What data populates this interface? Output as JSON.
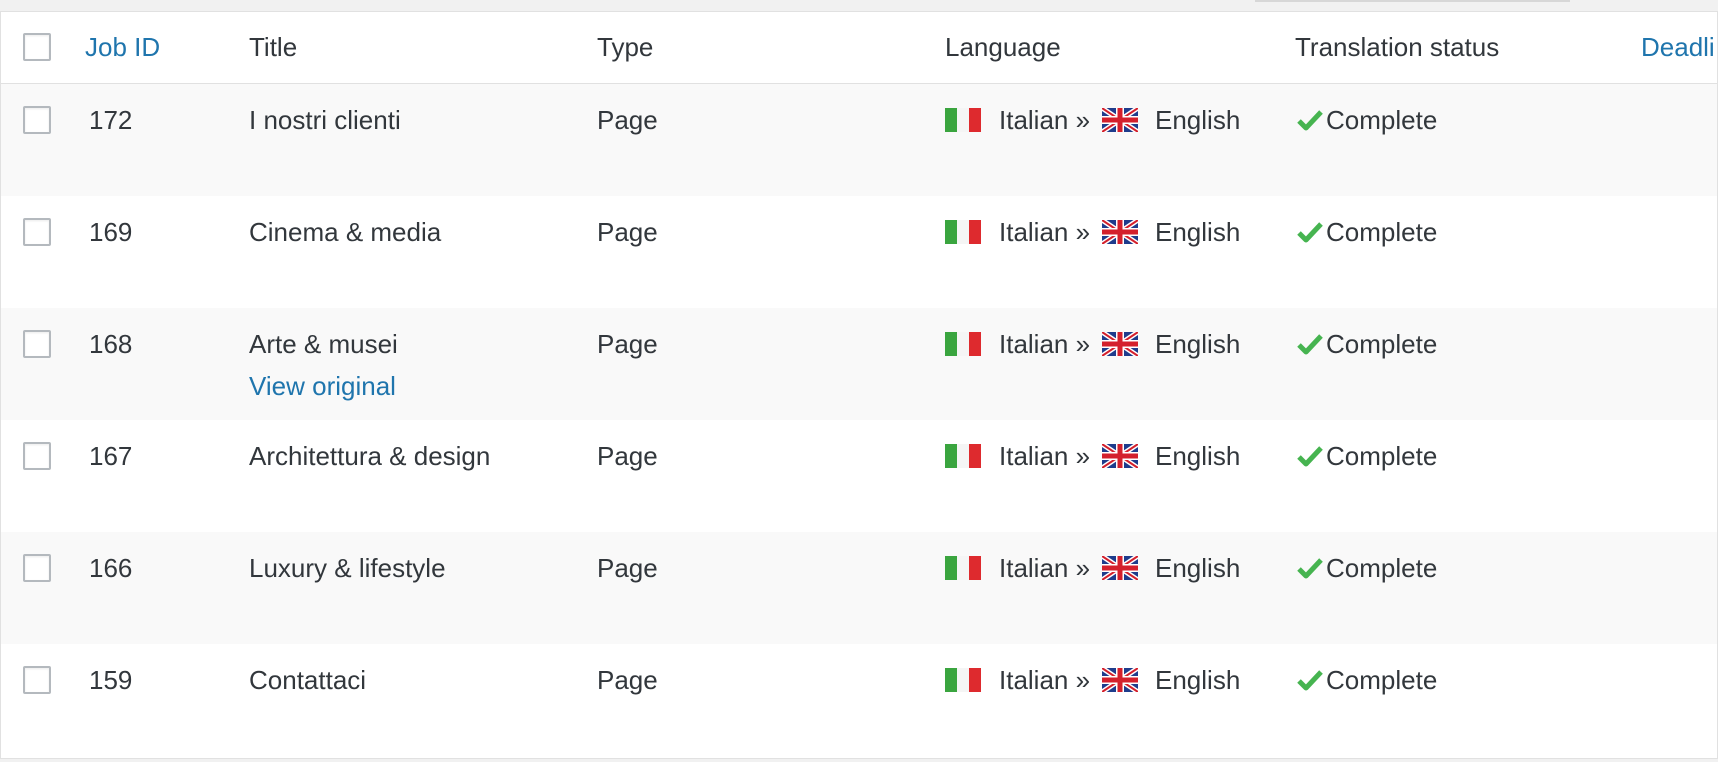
{
  "colors": {
    "link": "#1f75ad",
    "text": "#32373c",
    "check": "#46b450",
    "row_alt": "#f9f9f9"
  },
  "header": {
    "job_id": "Job ID",
    "title": "Title",
    "type": "Type",
    "language": "Language",
    "translation_status": "Translation status",
    "deadline": "Deadli"
  },
  "rows": [
    {
      "id": "172",
      "title": "I nostri clienti",
      "type": "Page",
      "from": "Italian »",
      "to": "English",
      "status": "Complete",
      "from_flag": "italy-flag-icon",
      "to_flag": "uk-flag-icon",
      "status_icon": "checkmark-icon"
    },
    {
      "id": "169",
      "title": "Cinema & media",
      "type": "Page",
      "from": "Italian »",
      "to": "English",
      "status": "Complete",
      "from_flag": "italy-flag-icon",
      "to_flag": "uk-flag-icon",
      "status_icon": "checkmark-icon"
    },
    {
      "id": "168",
      "title": "Arte & musei",
      "type": "Page",
      "from": "Italian »",
      "to": "English",
      "status": "Complete",
      "action": "View original",
      "from_flag": "italy-flag-icon",
      "to_flag": "uk-flag-icon",
      "status_icon": "checkmark-icon"
    },
    {
      "id": "167",
      "title": "Architettura & design",
      "type": "Page",
      "from": "Italian »",
      "to": "English",
      "status": "Complete",
      "from_flag": "italy-flag-icon",
      "to_flag": "uk-flag-icon",
      "status_icon": "checkmark-icon"
    },
    {
      "id": "166",
      "title": "Luxury & lifestyle",
      "type": "Page",
      "from": "Italian »",
      "to": "English",
      "status": "Complete",
      "from_flag": "italy-flag-icon",
      "to_flag": "uk-flag-icon",
      "status_icon": "checkmark-icon"
    },
    {
      "id": "159",
      "title": "Contattaci",
      "type": "Page",
      "from": "Italian »",
      "to": "English",
      "status": "Complete",
      "from_flag": "italy-flag-icon",
      "to_flag": "uk-flag-icon",
      "status_icon": "checkmark-icon"
    }
  ]
}
